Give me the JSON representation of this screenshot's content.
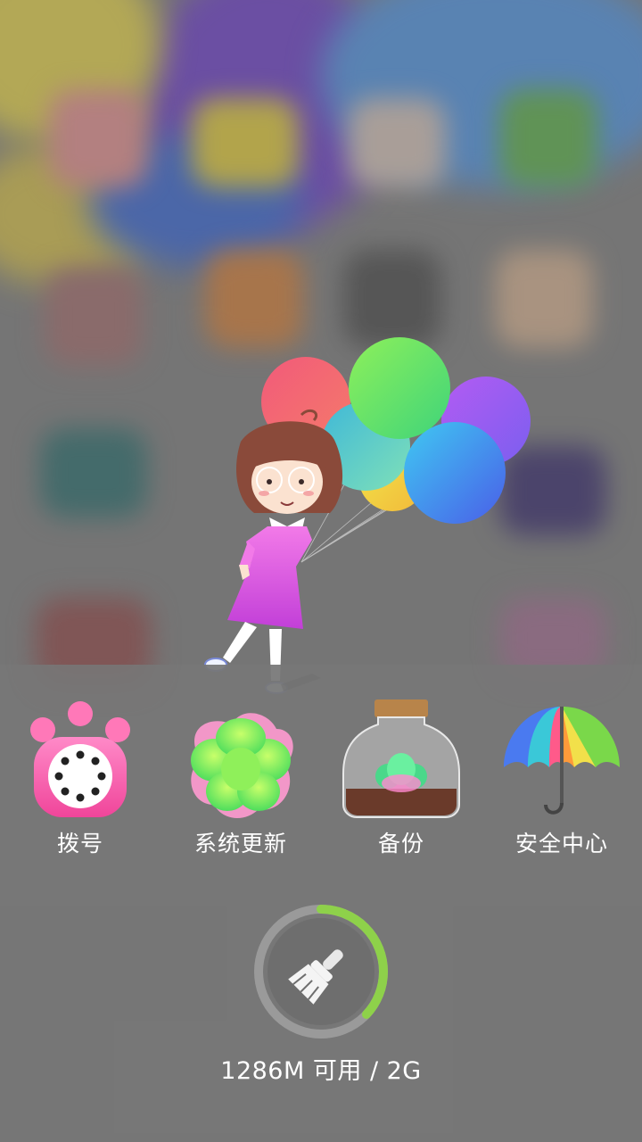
{
  "background": {
    "description_colors": [
      "#2f6fcf",
      "#7b3fc4",
      "#f2d64a",
      "#5ab84e",
      "#d04a4a"
    ]
  },
  "folder": {
    "apps": [
      {
        "id": "dialer",
        "label": "拨号",
        "icon": "telephone-paw-icon"
      },
      {
        "id": "system-update",
        "label": "系统更新",
        "icon": "succulent-icon"
      },
      {
        "id": "backup",
        "label": "备份",
        "icon": "terrarium-jar-icon"
      },
      {
        "id": "security-center",
        "label": "安全中心",
        "icon": "umbrella-icon"
      }
    ]
  },
  "cleaner": {
    "icon": "broom-icon",
    "used_fraction": 0.37,
    "ring_color": "#8ed14a",
    "memory_text": "1286M 可用 / 2G"
  },
  "colors": {
    "panel": "#767676",
    "label": "#ffffff",
    "accent_green": "#8ed14a"
  }
}
